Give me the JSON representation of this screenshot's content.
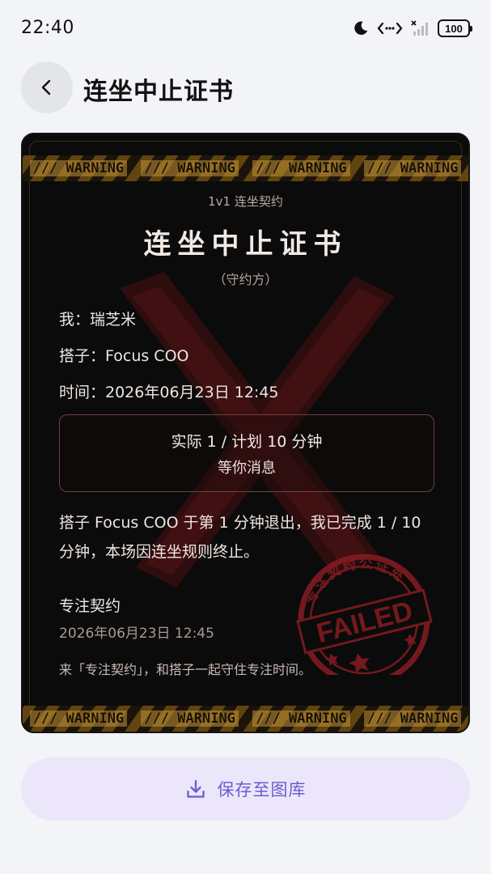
{
  "status_bar": {
    "time": "22:40",
    "battery": "100",
    "icons": [
      "moon-icon",
      "link-icon",
      "signal-off-icon",
      "battery-icon"
    ]
  },
  "header": {
    "back_icon": "chevron-left-icon",
    "title": "连坐中止证书"
  },
  "certificate": {
    "banner_text": "/// WARNING",
    "subtitle": "1v1 连坐契约",
    "title": "连坐中止证书",
    "role": "（守约方）",
    "me": "我：瑞芝米",
    "partner": "搭子：Focus COO",
    "time": "时间：2026年06月23日 12:45",
    "stats_main": "实际 1 / 计划 10 分钟",
    "stats_sub": "等你消息",
    "summary": "搭子 Focus COO 于第 1 分钟退出，我已完成 1 / 10 分钟，本场因连坐规则终止。",
    "brand_name": "专注契约",
    "brand_date": "2026年06月23日 12:45",
    "slogan": "来「专注契约」，和搭子一起守住专注时间。",
    "stamp_ring_text": "专注契约公证处",
    "stamp_word": "FAILED",
    "colors": {
      "stamp": "#8b1d22",
      "tape": "#b58a2f",
      "x_mark": "#5a1214"
    }
  },
  "save_button": {
    "label": "保存至图库",
    "icon": "download-icon",
    "accent": "#6e5bd0"
  }
}
